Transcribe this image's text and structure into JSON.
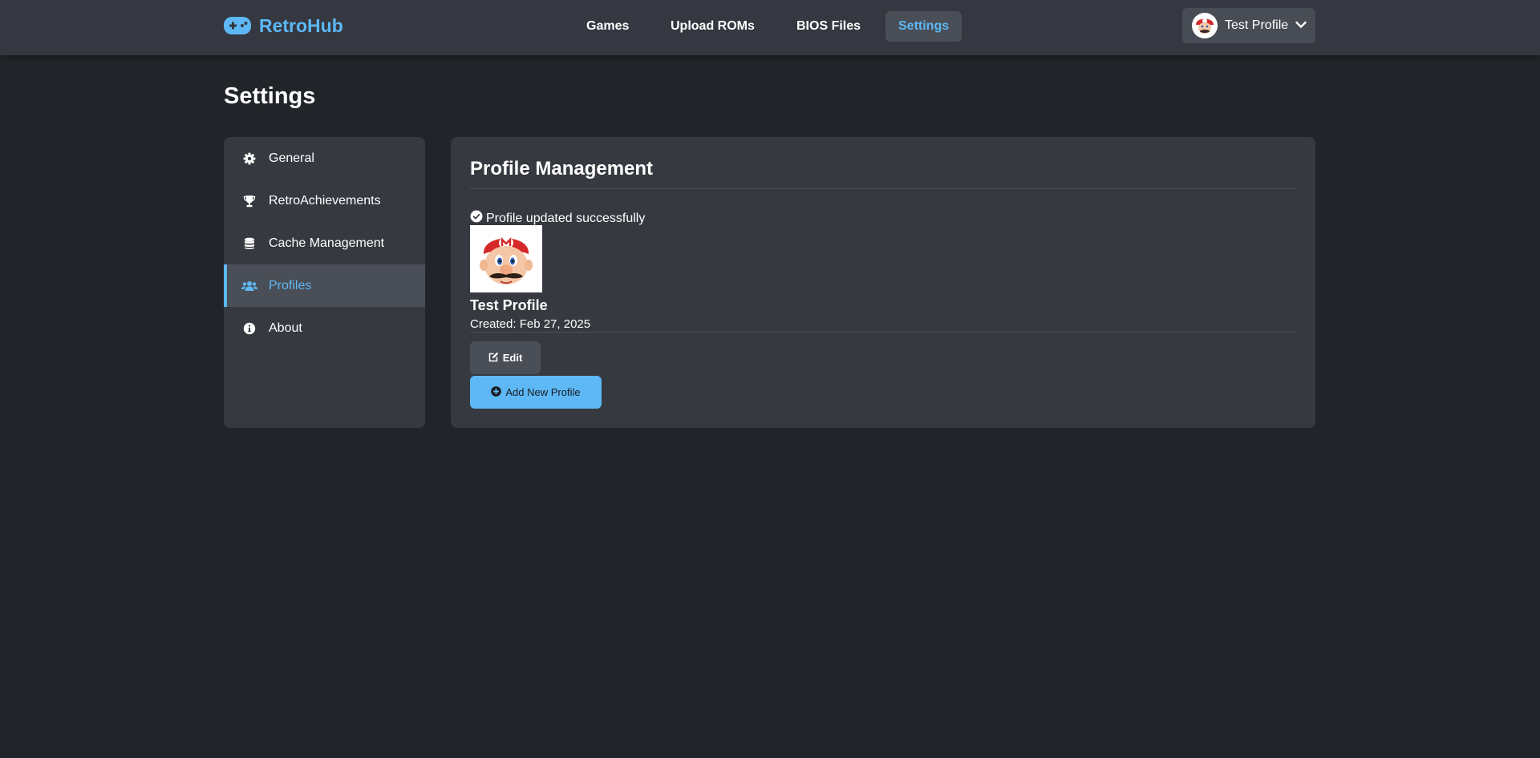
{
  "colors": {
    "accent": "#5db8f5",
    "background": "#212428",
    "header_bg": "#353840",
    "panel_bg": "#363940",
    "active_bg": "#4a4e56"
  },
  "header": {
    "brand": "RetroHub",
    "brand_icon": "gamepad-icon",
    "nav": [
      {
        "label": "Games"
      },
      {
        "label": "Upload ROMs"
      },
      {
        "label": "BIOS Files"
      },
      {
        "label": "Settings",
        "active": true
      }
    ],
    "profile": {
      "name": "Test Profile",
      "icon": "chevron-down-icon"
    }
  },
  "page": {
    "title": "Settings"
  },
  "sidebar": {
    "items": [
      {
        "label": "General",
        "icon": "gear-icon"
      },
      {
        "label": "RetroAchievements",
        "icon": "trophy-icon"
      },
      {
        "label": "Cache Management",
        "icon": "database-icon"
      },
      {
        "label": "Profiles",
        "icon": "users-icon",
        "active": true
      },
      {
        "label": "About",
        "icon": "info-icon"
      }
    ]
  },
  "main": {
    "title": "Profile Management",
    "success_message": "Profile updated successfully",
    "profile": {
      "name": "Test Profile",
      "created": "Created: Feb 27, 2025"
    },
    "edit_label": "Edit",
    "add_label": "Add New Profile"
  }
}
